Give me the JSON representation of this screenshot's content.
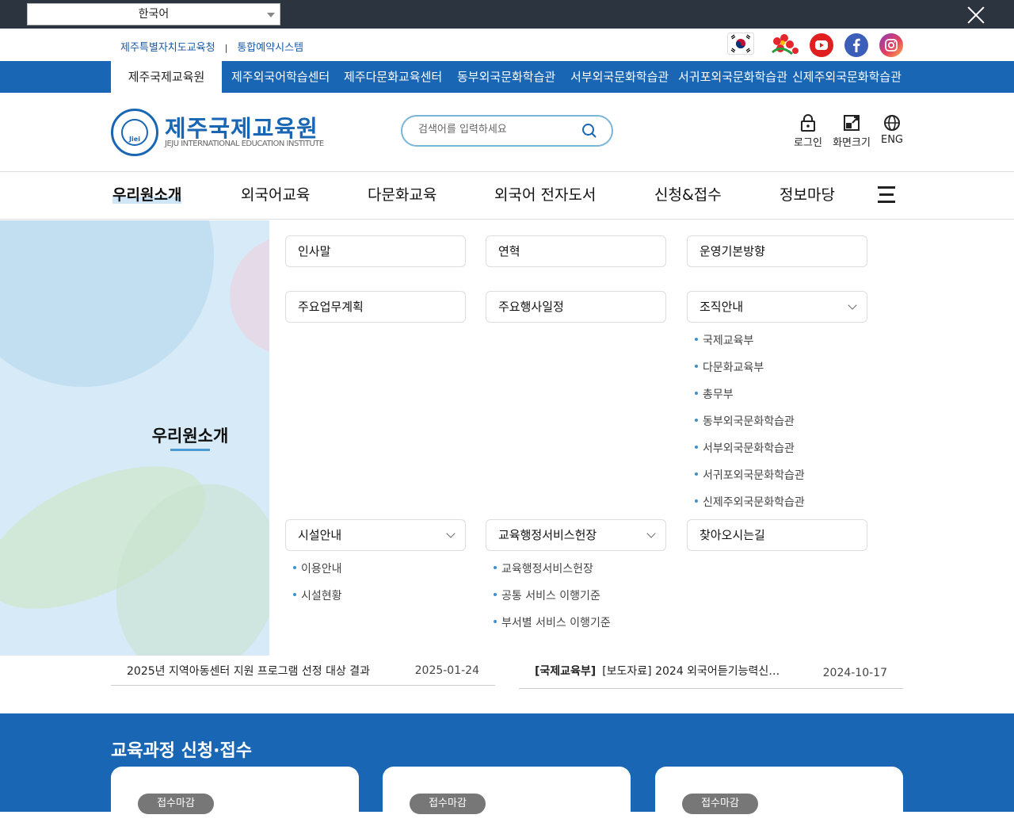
{
  "language_bar": {
    "selected": "한국어",
    "close_label": "닫기"
  },
  "top_links": [
    "제주특별자치도교육청",
    "통합예약시스템"
  ],
  "social_icons": [
    "korea-flag-icon",
    "jeju-symbol-icon",
    "youtube-icon",
    "facebook-icon",
    "instagram-icon"
  ],
  "site_bar": {
    "items": [
      "제주국제교육원",
      "제주외국어학습센터",
      "제주다문화교육센터",
      "동부외국문화학습관",
      "서부외국문화학습관",
      "서귀포외국문화학습관",
      "신제주외국문화학습관"
    ],
    "active_index": 0
  },
  "header": {
    "logo_emblem_text": "Jiei",
    "logo_title": "제주국제교육원",
    "logo_subtitle": "JEJU INTERNATIONAL EDUCATION INSTITUTE",
    "search_placeholder": "검색어를 입력하세요",
    "utils": {
      "login": "로그인",
      "screen_size": "화면크기",
      "eng": "ENG"
    }
  },
  "gnb": {
    "items": [
      "우리원소개",
      "외국어교육",
      "다문화교육",
      "외국어 전자도서",
      "신청&접수",
      "정보마당"
    ]
  },
  "mega_menu": {
    "title": "우리원소개",
    "boxes": {
      "greeting": "인사말",
      "history": "연혁",
      "policy": "운영기본방향",
      "plan": "주요업무계획",
      "schedule": "주요행사일정",
      "org": "조직안내",
      "facility": "시설안내",
      "charter": "교육행정서비스헌장",
      "directions": "찾아오시는길"
    },
    "org_subs": [
      "국제교육부",
      "다문화교육부",
      "총무부",
      "동부외국문화학습관",
      "서부외국문화학습관",
      "서귀포외국문화학습관",
      "신제주외국문화학습관"
    ],
    "facility_subs": [
      "이용안내",
      "시설현황"
    ],
    "charter_subs": [
      "교육행정서비스헌장",
      "공통 서비스 이행기준",
      "부서별 서비스 이행기준"
    ]
  },
  "news": [
    {
      "category": "",
      "title": "2025년 지역아동센터 지원 프로그램 선정 대상 결과",
      "date": "2025-01-24"
    },
    {
      "category": "[국제교육부]",
      "title": "[보도자료] 2024 외국어듣기능력신…",
      "date": "2024-10-17"
    }
  ],
  "courses": {
    "title": "교육과정 신청·접수",
    "cards": [
      {
        "status": "접수마감"
      },
      {
        "status": "접수마감"
      },
      {
        "status": "접수마감"
      }
    ]
  },
  "colors": {
    "primary": "#1866b4",
    "dark_bar": "#2c3440",
    "accent_light": "#d6ebf7"
  }
}
